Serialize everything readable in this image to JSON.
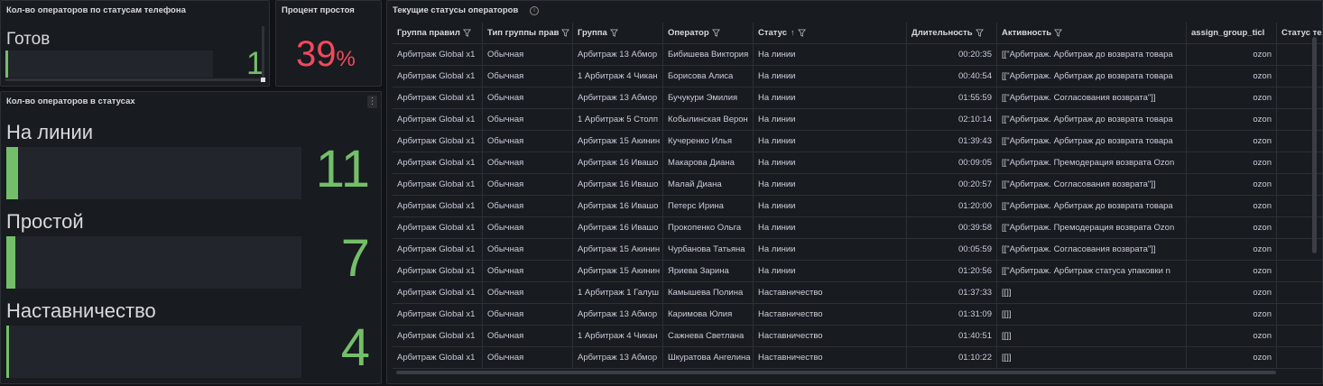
{
  "phone_panel": {
    "title": "Кол-во операторов по статусам телефона",
    "label": "Готов",
    "value": "1",
    "fill": 0.01
  },
  "idle_panel": {
    "title": "Процент простоя",
    "value": "39",
    "unit": "%"
  },
  "status_panel": {
    "title": "Кол-во операторов в статусах",
    "menu": "⋮",
    "rows": [
      {
        "label": "На линии",
        "value": "11",
        "fill": 0.04
      },
      {
        "label": "Простой",
        "value": "7",
        "fill": 0.03
      },
      {
        "label": "Наставничество",
        "value": "4",
        "fill": 0.01
      }
    ]
  },
  "table_panel": {
    "title": "Текущие статусы операторов",
    "info": "i",
    "headers": [
      "Группа правил",
      "Тип группы прав",
      "Группа",
      "Оператор",
      "Статус",
      "Длительность",
      "Активность",
      "assign_group_ticl",
      "Статус теле"
    ],
    "rows": [
      [
        "Арбитраж Global x1",
        "Обычная",
        "Арбитраж 13 Абмор",
        "Бибишева Виктория",
        "На линии",
        "00:20:35",
        "[[\"Арбитраж. Арбитраж до возврата товара",
        "ozon",
        ""
      ],
      [
        "Арбитраж Global x1",
        "Обычная",
        "1 Арбитраж 4 Чикан",
        "Борисова Алиса",
        "На линии",
        "00:40:54",
        "[[\"Арбитраж. Арбитраж до возврата товара",
        "ozon",
        ""
      ],
      [
        "Арбитраж Global x1",
        "Обычная",
        "Арбитраж 13 Абмор",
        "Бучукури Эмилия",
        "На линии",
        "01:55:59",
        "[[\"Арбитраж. Согласования возврата\"]]",
        "ozon",
        ""
      ],
      [
        "Арбитраж Global x1",
        "Обычная",
        "1 Арбитраж 5 Столп",
        "Кобылинская Верон",
        "На линии",
        "02:10:14",
        "[[\"Арбитраж. Арбитраж до возврата товара",
        "ozon",
        ""
      ],
      [
        "Арбитраж Global x1",
        "Обычная",
        "Арбитраж 15 Акинин",
        "Кучеренко Илья",
        "На линии",
        "01:39:43",
        "[[\"Арбитраж. Арбитраж до возврата товара",
        "ozon",
        ""
      ],
      [
        "Арбитраж Global x1",
        "Обычная",
        "Арбитраж 16 Ивашо",
        "Макарова Диана",
        "На линии",
        "00:09:05",
        "[[\"Арбитраж. Премодерация возврата Ozon",
        "ozon",
        ""
      ],
      [
        "Арбитраж Global x1",
        "Обычная",
        "Арбитраж 16 Ивашо",
        "Малай Диана",
        "На линии",
        "00:20:57",
        "[[\"Арбитраж. Согласования возврата\"]]",
        "ozon",
        ""
      ],
      [
        "Арбитраж Global x1",
        "Обычная",
        "Арбитраж 16 Ивашо",
        "Петерс Ирина",
        "На линии",
        "01:20:00",
        "[[\"Арбитраж. Арбитраж до возврата товара",
        "ozon",
        ""
      ],
      [
        "Арбитраж Global x1",
        "Обычная",
        "Арбитраж 16 Ивашо",
        "Прокопенко Ольга",
        "На линии",
        "00:39:58",
        "[[\"Арбитраж. Премодерация возврата Ozon",
        "ozon",
        ""
      ],
      [
        "Арбитраж Global x1",
        "Обычная",
        "Арбитраж 15 Акинин",
        "Чурбанова Татьяна",
        "На линии",
        "00:05:59",
        "[[\"Арбитраж. Согласования возврата\"]]",
        "ozon",
        ""
      ],
      [
        "Арбитраж Global x1",
        "Обычная",
        "Арбитраж 15 Акинин",
        "Яриева Зарина",
        "На линии",
        "01:20:56",
        "[[\"Арбитраж. Арбитраж статуса упаковки n",
        "ozon",
        ""
      ],
      [
        "Арбитраж Global x1",
        "Обычная",
        "1 Арбитраж 1 Галуш",
        "Камышева Полина",
        "Наставничество",
        "01:37:33",
        "[[]]",
        "ozon",
        ""
      ],
      [
        "Арбитраж Global x1",
        "Обычная",
        "Арбитраж 13 Абмор",
        "Каримова Юлия",
        "Наставничество",
        "01:31:09",
        "[[]]",
        "ozon",
        ""
      ],
      [
        "Арбитраж Global x1",
        "Обычная",
        "1 Арбитраж 4 Чикан",
        "Сажнева Светлана",
        "Наставничество",
        "01:40:51",
        "[[]]",
        "ozon",
        ""
      ],
      [
        "Арбитраж Global x1",
        "Обычная",
        "Арбитраж 13 Абмор",
        "Шкуратова Ангелина",
        "Наставничество",
        "01:10:22",
        "[[]]",
        "ozon",
        ""
      ]
    ]
  },
  "colors": {
    "bg": "#111217",
    "panel": "#181b1f",
    "green": "#73bf69",
    "red": "#f2495c"
  }
}
